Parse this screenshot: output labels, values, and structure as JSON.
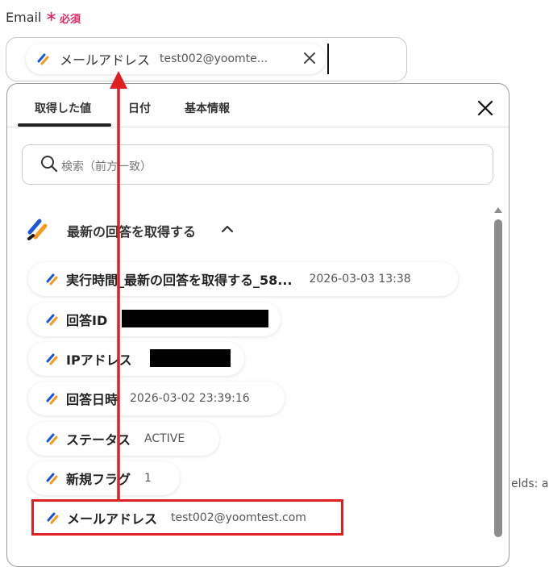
{
  "field": {
    "label": "Email",
    "required_mark": "∗",
    "required_text": "必須",
    "selected_chip": {
      "name": "メールアドレス",
      "value": "test002@yoomte..."
    }
  },
  "dropdown": {
    "tabs": [
      {
        "label": "取得した値",
        "active": true
      },
      {
        "label": "日付",
        "active": false
      },
      {
        "label": "基本情報",
        "active": false
      }
    ],
    "search_placeholder": "検索（前方一致）",
    "section_title": "最新の回答を取得する",
    "items": [
      {
        "name": "実行時間_最新の回答を取得する_58...",
        "value": "2026-03-03 13:38"
      },
      {
        "name": "回答ID",
        "value": ""
      },
      {
        "name": "IPアドレス",
        "value": ""
      },
      {
        "name": "回答日時",
        "value": "2026-03-02 23:39:16"
      },
      {
        "name": "ステータス",
        "value": "ACTIVE"
      },
      {
        "name": "新規フラグ",
        "value": "1"
      },
      {
        "name": "メールアドレス",
        "value": "test002@yoomtest.com"
      }
    ]
  },
  "background_text": "elds: ar",
  "colors": {
    "required": "#e0245e",
    "annotation_red": "#e02020",
    "icon_blue": "#1e55d8",
    "icon_orange": "#f59a1a"
  }
}
